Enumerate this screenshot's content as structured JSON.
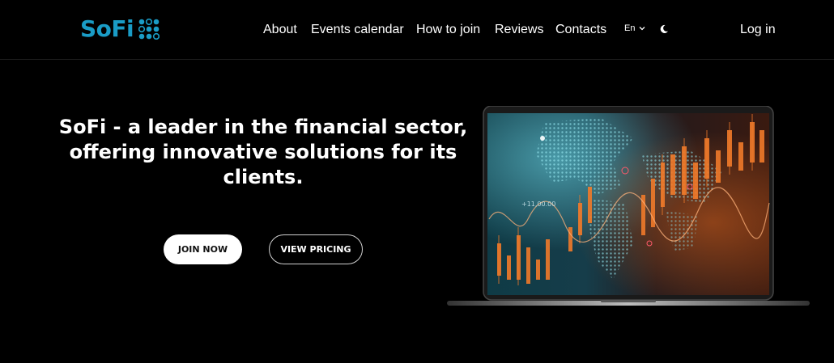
{
  "header": {
    "logo_text": "SoFi",
    "nav": [
      {
        "label": "About"
      },
      {
        "label": "Events calendar"
      },
      {
        "label": "How to join"
      },
      {
        "label": "Reviews"
      },
      {
        "label": "Contacts"
      }
    ],
    "language": "En",
    "login_label": "Log in"
  },
  "hero": {
    "headline": "SoFi - a leader in the financial sector, offering innovative solutions for its clients.",
    "join_button": "JOIN NOW",
    "pricing_button": "VIEW PRICING",
    "screen_overlay_text": "+11,00.00"
  },
  "colors": {
    "brand": "#1a9cc6",
    "background": "#000000",
    "chart_orange": "#f07a2a",
    "map_teal": "#3aa7b6"
  },
  "icons": {
    "logo_mark": "dots-grid-icon",
    "lang_caret": "chevron-down-icon",
    "theme": "moon-icon"
  }
}
